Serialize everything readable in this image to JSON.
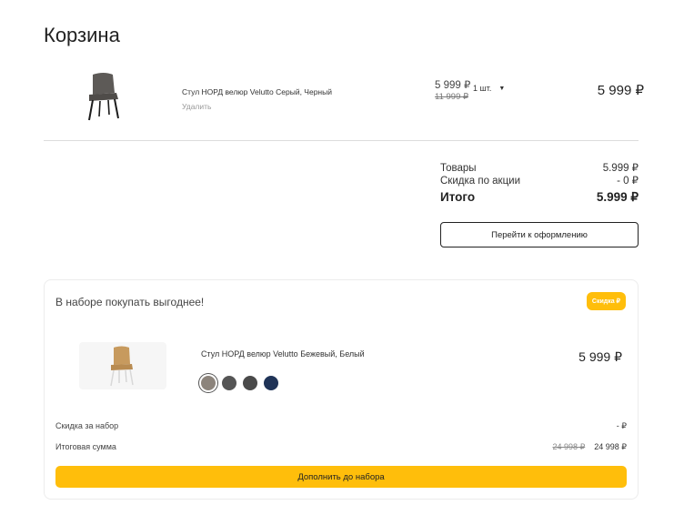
{
  "page": {
    "title": "Корзина"
  },
  "cart_item": {
    "name": "Стул НОРД велюр Velutto Серый, Черный",
    "remove_label": "Удалить",
    "price": "5 999 ₽",
    "old_price": "11 999 ₽",
    "quantity": "1 шт.",
    "total": "5 999 ₽",
    "thumb_icon": "gray-velour-chair-image"
  },
  "summary": {
    "goods_label": "Товары",
    "goods_value": "5.999 ₽",
    "discount_label": "Скидка по акции",
    "discount_value": "- 0 ₽",
    "total_label": "Итого",
    "total_value": "5.999 ₽",
    "checkout_button": "Перейти к оформлению"
  },
  "bundle": {
    "title": "В наборе покупать выгоднее!",
    "badge": "Скидка ₽",
    "product_name": "Стул НОРД велюр Velutto Бежевый, Белый",
    "product_price": "5 999 ₽",
    "thumb_icon": "beige-chair-image",
    "swatches": [
      "#8c847c",
      "#555555",
      "#4a4a4a",
      "#1f3357"
    ],
    "discount_label": "Скидка за набор",
    "discount_value": "- ₽",
    "sum_label": "Итоговая сумма",
    "sum_old": "24 998 ₽",
    "sum_new": "24 998 ₽",
    "fill_button": "Дополнить до набора"
  },
  "colors": {
    "accent": "#ffbe0b",
    "divider": "#dcdcdc"
  }
}
